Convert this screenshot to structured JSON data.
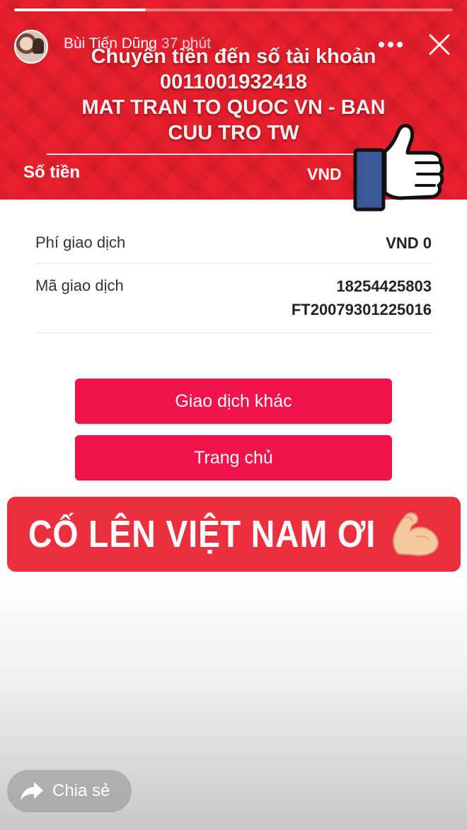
{
  "story": {
    "user_name": "Bùi Tiến Dũng",
    "time_ago": "37 phút",
    "progress": 0.3
  },
  "transfer": {
    "title_lines": [
      "Chuyển tiền đến số tài khoản",
      "0011001932418",
      "MAT TRAN TO QUOC VN - BAN",
      "CUU TRO TW"
    ],
    "amount_label": "Số tiền",
    "amount_currency": "VND"
  },
  "details": {
    "fee_label": "Phí giao dịch",
    "fee_value": "VND 0",
    "code_label": "Mã giao dịch",
    "code_value_1": "18254425803",
    "code_value_2": "FT20079301225016"
  },
  "buttons": {
    "other_transaction": "Giao dịch khác",
    "home": "Trang chủ"
  },
  "sticker": {
    "text": "CỐ LÊN VIỆT NAM ƠI"
  },
  "share": {
    "label": "Chia sẻ"
  },
  "colors": {
    "banner_red": "#e8202e",
    "button_red": "#f0124a",
    "sticker_red": "#ec2f3f",
    "thumb_blue": "#3b5998"
  },
  "icons": [
    "more-icon",
    "close-icon",
    "thumbs-up-icon",
    "flexed-biceps-icon",
    "share-arrow-icon"
  ]
}
